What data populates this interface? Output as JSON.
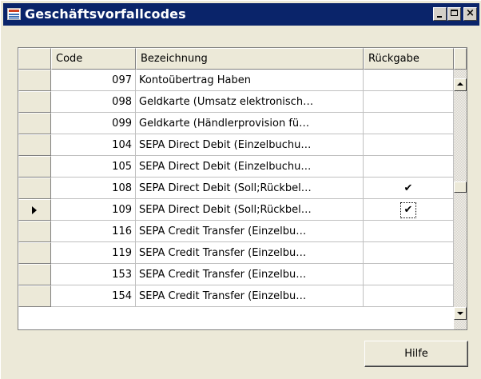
{
  "window": {
    "title": "Geschäftsvorfallcodes",
    "title_bar_color": "#0a246a",
    "icon": "table-icon"
  },
  "grid": {
    "columns": [
      "Code",
      "Bezeichnung",
      "Rückgabe"
    ],
    "current_row_index": 6,
    "rows": [
      {
        "code": "097",
        "bezeichnung": "Kontoübertrag Haben",
        "rueckgabe": false
      },
      {
        "code": "098",
        "bezeichnung": "Geldkarte (Umsatz elektronisch…",
        "rueckgabe": false
      },
      {
        "code": "099",
        "bezeichnung": "Geldkarte (Händlerprovision fü…",
        "rueckgabe": false
      },
      {
        "code": "104",
        "bezeichnung": "SEPA Direct Debit (Einzelbuchu…",
        "rueckgabe": false
      },
      {
        "code": "105",
        "bezeichnung": "SEPA Direct Debit (Einzelbuchu…",
        "rueckgabe": false
      },
      {
        "code": "108",
        "bezeichnung": "SEPA Direct Debit (Soll;Rückbel…",
        "rueckgabe": true
      },
      {
        "code": "109",
        "bezeichnung": "SEPA Direct Debit (Soll;Rückbel…",
        "rueckgabe": true
      },
      {
        "code": "116",
        "bezeichnung": "SEPA Credit Transfer (Einzelbu…",
        "rueckgabe": false
      },
      {
        "code": "119",
        "bezeichnung": "SEPA Credit Transfer (Einzelbu…",
        "rueckgabe": false
      },
      {
        "code": "153",
        "bezeichnung": "SEPA Credit Transfer (Einzelbu…",
        "rueckgabe": false
      },
      {
        "code": "154",
        "bezeichnung": "SEPA Credit Transfer (Einzelbu…",
        "rueckgabe": false
      }
    ],
    "check_glyph": "✔"
  },
  "buttons": {
    "help_label": "Hilfe"
  }
}
